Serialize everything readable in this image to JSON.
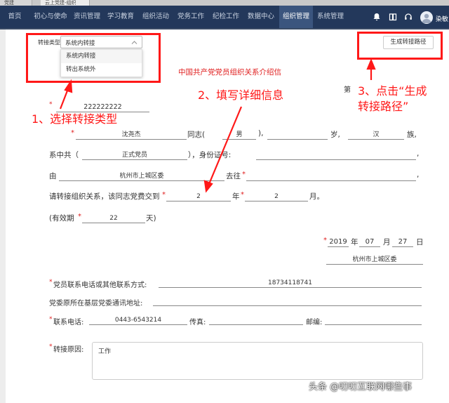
{
  "browser_tabs": [
    "党建",
    "云上党建-组织"
  ],
  "nav": {
    "items": [
      "首页",
      "初心与使命",
      "资讯管理",
      "学习教育",
      "组织活动",
      "党务工作",
      "纪检工作",
      "数据中心",
      "组织管理",
      "系统管理"
    ],
    "active_index": 8,
    "user_name": "染敏"
  },
  "transfer": {
    "type_label": "转接类型",
    "type_value": "系统内转接",
    "options": [
      "系统内转接",
      "转出系统外"
    ],
    "generate_button": "生成转接路径"
  },
  "letter": {
    "title": "中国共产党党员组织关系介绍信",
    "number_prefix": "第",
    "recipient": "222222222",
    "name": "沈尧杰",
    "comrade": "同志(",
    "gender": "男",
    "age_suffix": "岁,",
    "ethnicity": "汉",
    "ethnicity_suffix": "族,",
    "party_prefix": "系中共（",
    "party_status": "正式党员",
    "id_label": "），身份证号:",
    "from_prefix": "由",
    "from_org": "杭州市上城区委",
    "to_label": "去往",
    "dues_text": "请转接组织关系，该同志党费交到",
    "dues_year": "2",
    "year_unit": "年",
    "dues_month": "2",
    "month_unit": "月。",
    "valid_prefix": "(有效期",
    "valid_days": "22",
    "valid_suffix": "天)",
    "date_year": "2019",
    "date_month": "07",
    "date_day": "27",
    "date_units": [
      "年",
      "月",
      "日"
    ],
    "issuer": "杭州市上城区委",
    "contact_label": "党员联系电话或其他联系方式:",
    "contact_value": "18734118741",
    "address_label": "党委原所在基层党委通讯地址:",
    "phone_label": "联系电话:",
    "phone_value": "0443-6543214",
    "fax_label": "传真:",
    "postcode_label": "邮编:",
    "reason_label": "转接原因:",
    "reason_value": "工作"
  },
  "annotations": {
    "step1": "1、选择转接类型",
    "step2": "2、填写详细信息",
    "step3_line1": "3、点击“生成",
    "step3_line2": "转接路径”",
    "watermark": "头条 @叨叨互联网哪些事"
  },
  "colors": {
    "nav_bg": "#23385b",
    "nav_active": "#3b557e",
    "annotation_red": "#ff1818",
    "title_red": "#e02020"
  }
}
